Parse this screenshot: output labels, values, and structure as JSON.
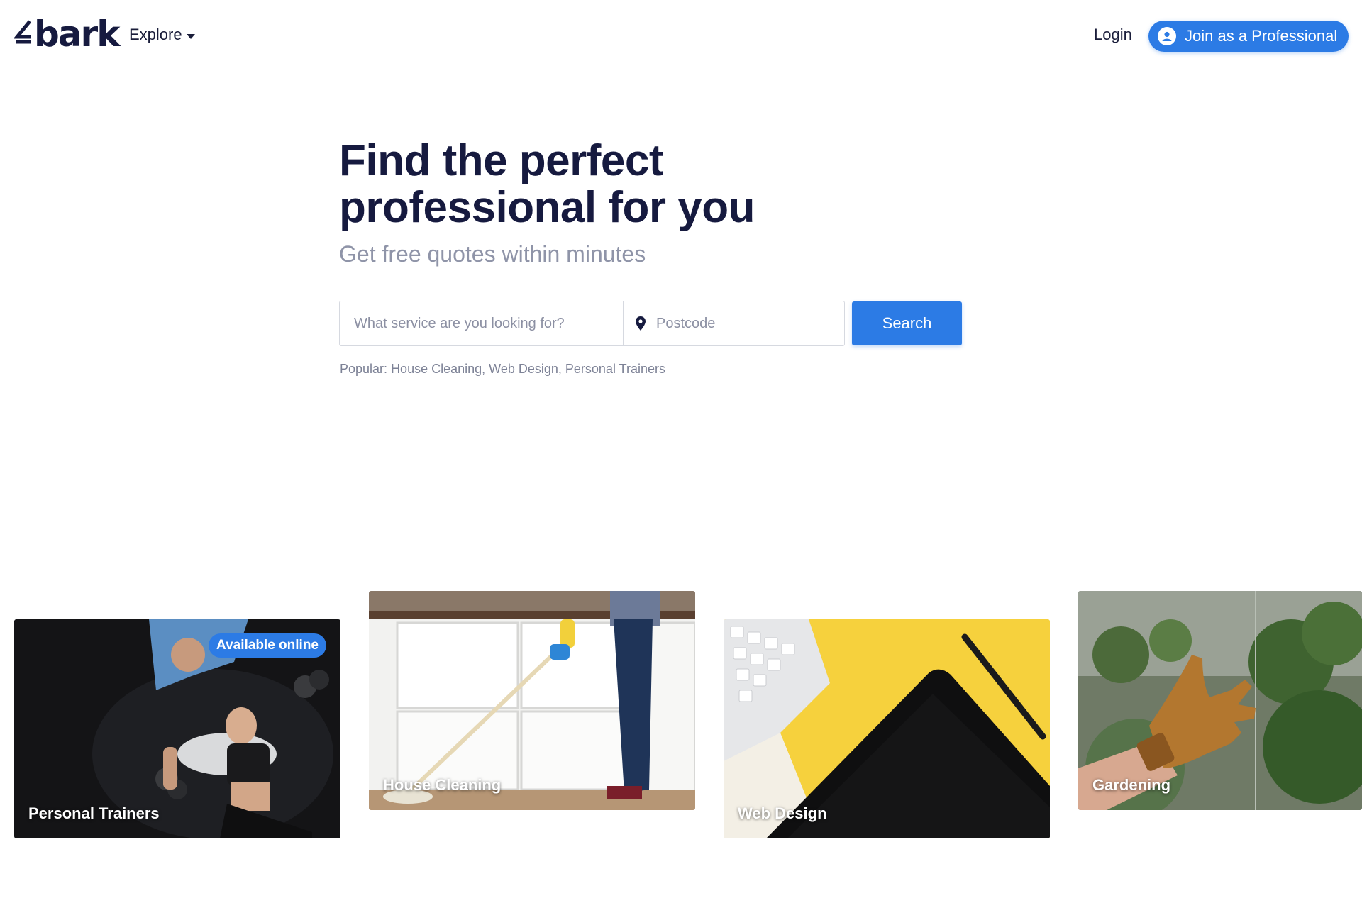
{
  "header": {
    "logo_text": "bark",
    "explore_label": "Explore",
    "login_label": "Login",
    "join_label": "Join as a Professional"
  },
  "hero": {
    "title_line1": "Find the perfect",
    "title_line2": "professional for you",
    "subtitle": "Get free quotes within minutes"
  },
  "search": {
    "service_placeholder": "What service are you looking for?",
    "postcode_placeholder": "Postcode",
    "button_label": "Search"
  },
  "popular": {
    "prefix": "Popular:",
    "items": [
      "House Cleaning",
      "Web Design",
      "Personal Trainers"
    ]
  },
  "cards": [
    {
      "label": "Personal Trainers",
      "badge": "Available online"
    },
    {
      "label": "House Cleaning"
    },
    {
      "label": "Web Design"
    },
    {
      "label": "Gardening"
    }
  ],
  "colors": {
    "accent": "#2c7be5",
    "heading": "#161a3f",
    "muted": "#8f94a8"
  }
}
